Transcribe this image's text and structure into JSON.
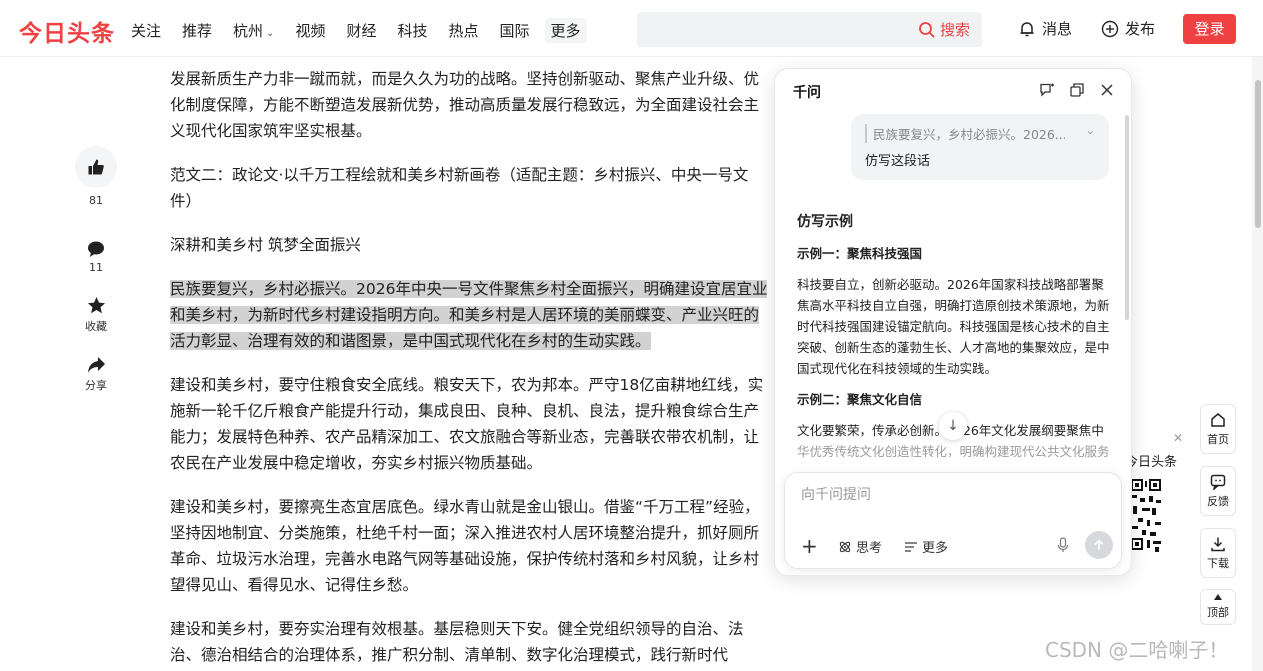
{
  "header": {
    "logo": "今日头条",
    "nav": [
      "关注",
      "推荐",
      "杭州",
      "视频",
      "财经",
      "科技",
      "热点",
      "国际"
    ],
    "nav_more": "更多",
    "search_button": "搜索",
    "messages": "消息",
    "publish": "发布",
    "login": "登录"
  },
  "rail": {
    "like_count": "81",
    "comment_count": "11",
    "favorite": "收藏",
    "share": "分享"
  },
  "article": {
    "p1": "发展新质生产力非一蹴而就，而是久久为功的战略。坚持创新驱动、聚焦产业升级、优化制度保障，方能不断塑造发展新优势，推动高质量发展行稳致远，为全面建设社会主义现代化国家筑牢坚实根基。",
    "p2": "范文二：政论文·以千万工程绘就和美乡村新画卷（适配主题：乡村振兴、中央一号文件）",
    "p3": "深耕和美乡村 筑梦全面振兴",
    "p4": "民族要复兴，乡村必振兴。2026年中央一号文件聚焦乡村全面振兴，明确建设宜居宜业和美乡村，为新时代乡村建设指明方向。和美乡村是人居环境的美丽蝶变、产业兴旺的活力彰显、治理有效的和谐图景，是中国式现代化在乡村的生动实践。",
    "p5": "建设和美乡村，要守住粮食安全底线。粮安天下，农为邦本。严守18亿亩耕地红线，实施新一轮千亿斤粮食产能提升行动，集成良田、良种、良机、良法，提升粮食综合生产能力；发展特色种养、农产品精深加工、农文旅融合等新业态，完善联农带农机制，让农民在产业发展中稳定增收，夯实乡村振兴物质基础。",
    "p6": "建设和美乡村，要擦亮生态宜居底色。绿水青山就是金山银山。借鉴“千万工程”经验，坚持因地制宜、分类施策，杜绝千村一面；深入推进农村人居环境整治提升，抓好厕所革命、垃圾污水治理，完善水电路气网等基础设施，保护传统村落和乡村风貌，让乡村望得见山、看得见水、记得住乡愁。",
    "p7": "建设和美乡村，要夯实治理有效根基。基层稳则天下安。健全党组织领导的自治、法治、德治相结合的治理体系，推广积分制、清单制、数字化治理模式，践行新时代"
  },
  "panel": {
    "title": "千问",
    "quote": "民族要复兴，乡村必振兴。2026...",
    "user_message": "仿写这段话",
    "heading": "仿写示例",
    "ex1_title": "示例一：聚焦科技强国",
    "ex1_body": "科技要自立，创新必驱动。2026年国家科技战略部署聚焦高水平科技自立自强，明确打造原创技术策源地，为新时代科技强国建设锚定航向。科技强国是核心技术的自主突破、创新生态的蓬勃生长、人才高地的集聚效应，是中国式现代化在科技领域的生动实践。",
    "ex2_title": "示例二：聚焦文化自信",
    "ex2_line1": "文化要繁荣，传承必创新。2026年文化发展纲要聚焦中",
    "ex2_line2": "华优秀传统文化创造性转化，明确构建现代公共文化服务",
    "input_placeholder": "向千问提问",
    "think": "思考",
    "more": "更多"
  },
  "tools": {
    "home": "首页",
    "feedback": "反馈",
    "download": "下载",
    "top": "顶部"
  },
  "qr": {
    "title": "今日头条"
  },
  "watermark": "CSDN @二哈喇子！"
}
